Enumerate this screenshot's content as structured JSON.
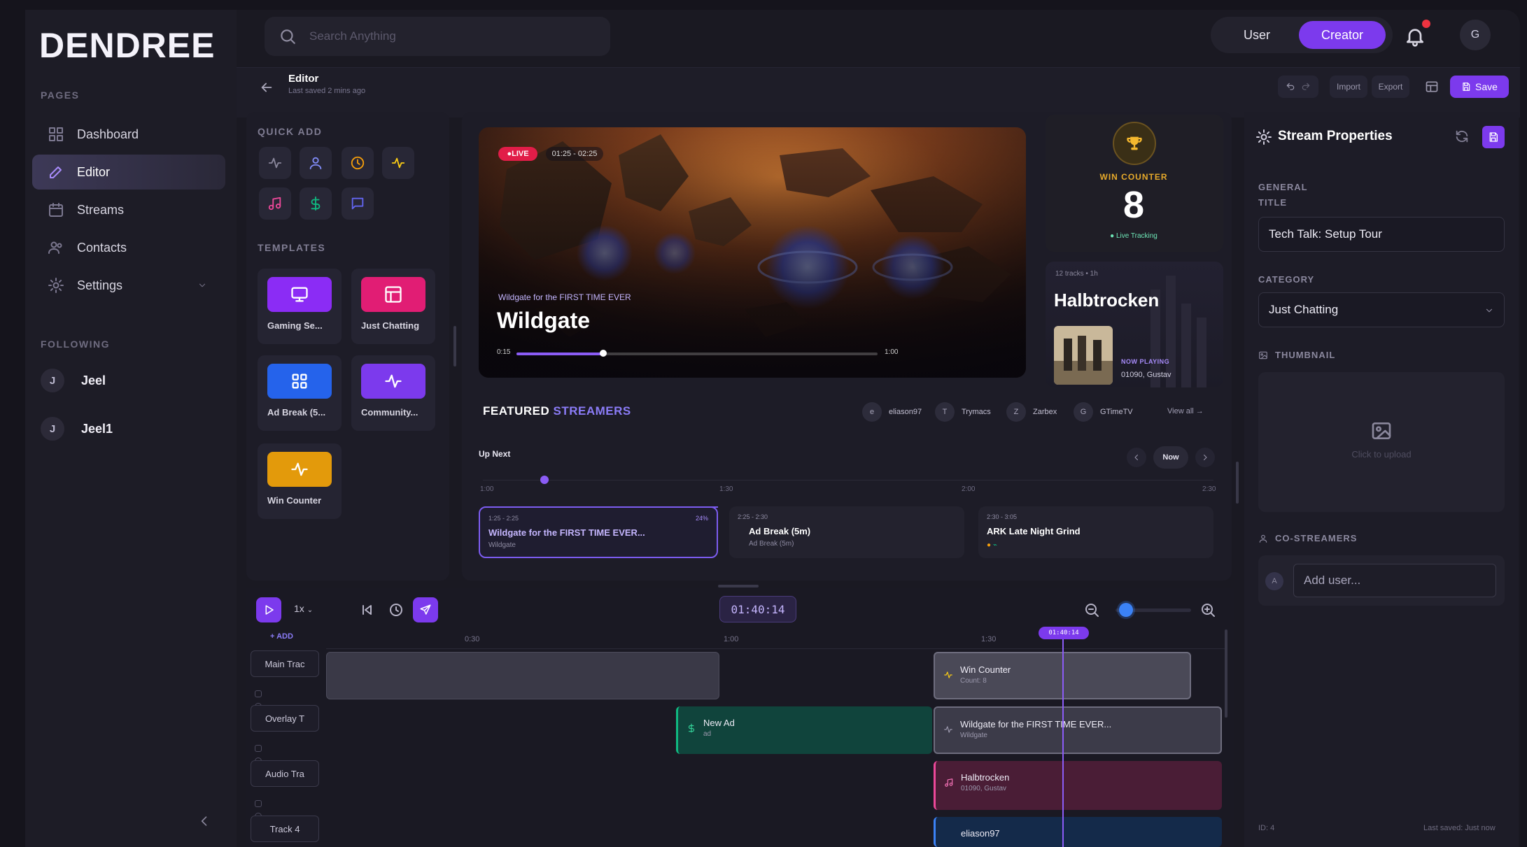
{
  "app": {
    "logo": "DENDREE"
  },
  "sidebar": {
    "pages_heading": "PAGES",
    "items": [
      {
        "label": "Dashboard",
        "icon": "dashboard-icon"
      },
      {
        "label": "Editor",
        "icon": "edit-icon",
        "active": true
      },
      {
        "label": "Streams",
        "icon": "calendar-icon"
      },
      {
        "label": "Contacts",
        "icon": "users-icon"
      },
      {
        "label": "Settings",
        "icon": "gear-icon"
      }
    ],
    "following_heading": "FOLLOWING",
    "following": [
      {
        "initial": "J",
        "name": "Jeel"
      },
      {
        "initial": "J",
        "name": "Jeel1"
      }
    ]
  },
  "topbar": {
    "search_placeholder": "Search Anything",
    "mode_user": "User",
    "mode_creator": "Creator",
    "profile_initial": "G"
  },
  "editor_header": {
    "title": "Editor",
    "subtitle": "Last saved 2 mins ago",
    "import_label": "Import",
    "export_label": "Export",
    "save_label": "Save"
  },
  "quick_add": {
    "heading": "QUICK ADD",
    "buttons": [
      {
        "icon": "activity-icon",
        "color": "#8a879c"
      },
      {
        "icon": "user-icon",
        "color": "#8a879c"
      },
      {
        "icon": "clock-icon",
        "color": "#f59e0b"
      },
      {
        "icon": "pulse-icon",
        "color": "#facc15"
      },
      {
        "icon": "music-icon",
        "color": "#ec4899"
      },
      {
        "icon": "dollar-icon",
        "color": "#10b981"
      },
      {
        "icon": "chat-icon",
        "color": "#6366f1"
      }
    ]
  },
  "templates": {
    "heading": "TEMPLATES",
    "items": [
      {
        "label": "Gaming Se...",
        "color": "#8b2cf5",
        "icon": "monitor-icon"
      },
      {
        "label": "Just Chatting",
        "color": "#e11d74",
        "icon": "layout-icon"
      },
      {
        "label": "Ad Break (5...",
        "color": "#2563eb",
        "icon": "grid-icon"
      },
      {
        "label": "Community...",
        "color": "#7c3aed",
        "icon": "activity-icon"
      },
      {
        "label": "Win Counter",
        "color": "#e39a0b",
        "icon": "activity-icon"
      }
    ]
  },
  "stage": {
    "live_label": "LIVE",
    "time_range": "01:25 - 02:25",
    "subtitle": "Wildgate for the FIRST TIME EVER",
    "title": "Wildgate",
    "progress": 0.24,
    "progress_start": "0:15",
    "progress_end": "1:00"
  },
  "win_counter": {
    "label": "WIN COUNTER",
    "count": "8",
    "status": "Live Tracking"
  },
  "now_playing": {
    "meta": "12 tracks  •  1h",
    "title": "Halbtrocken",
    "label": "NOW PLAYING",
    "artist": "01090, Gustav"
  },
  "featured": {
    "title_part1": "FEATURED",
    "title_part2": "STREAMERS",
    "streamers": [
      {
        "initial": "e",
        "name": "eliason97"
      },
      {
        "initial": "T",
        "name": "Trymacs"
      },
      {
        "initial": "Z",
        "name": "Zarbex"
      },
      {
        "initial": "G",
        "name": "GTimeTV"
      }
    ],
    "view_all": "View all →"
  },
  "up_next": {
    "label": "Up Next",
    "now_label": "Now",
    "ticks": [
      "1:00",
      "1:30",
      "2:00",
      "2:30"
    ],
    "cards": [
      {
        "time": "1:25 - 2:25",
        "title": "Wildgate for the FIRST TIME EVER...",
        "sub": "Wildgate",
        "percent": "24%"
      },
      {
        "time": "2:25 - 2:30",
        "title": "Ad Break (5m)",
        "sub": "Ad Break (5m)"
      },
      {
        "time": "2:30 - 3:05",
        "title": "ARK Late Night Grind",
        "sub": ""
      }
    ]
  },
  "timeline": {
    "speed": "1x",
    "timecode": "01:40:14",
    "zoom": 0.05,
    "add_label": "+ ADD",
    "ruler": [
      "0:30",
      "1:00",
      "1:30"
    ],
    "playhead_time": "01:40:14",
    "tracks": [
      "Main Trac",
      "Overlay T",
      "Audio Tra",
      "Track 4"
    ],
    "clips": [
      {
        "title": "Win Counter",
        "sub": "Count: 8"
      },
      {
        "title": "New Ad",
        "sub": "ad"
      },
      {
        "title": "Wildgate for the FIRST TIME EVER...",
        "sub": "Wildgate"
      },
      {
        "title": "Halbtrocken",
        "sub": "01090, Gustav"
      },
      {
        "title": "eliason97",
        "sub": ""
      }
    ]
  },
  "properties": {
    "title": "Stream Properties",
    "general_label": "GENERAL",
    "title_label": "TITLE",
    "title_value": "Tech Talk: Setup Tour",
    "category_label": "CATEGORY",
    "category_value": "Just Chatting",
    "thumbnail_label": "THUMBNAIL",
    "thumbnail_hint": "Click to upload",
    "costreamers_label": "CO-STREAMERS",
    "add_user_placeholder": "Add user...",
    "add_user_initial": "A",
    "id_text": "ID: 4",
    "last_saved": "Last saved: Just now"
  }
}
